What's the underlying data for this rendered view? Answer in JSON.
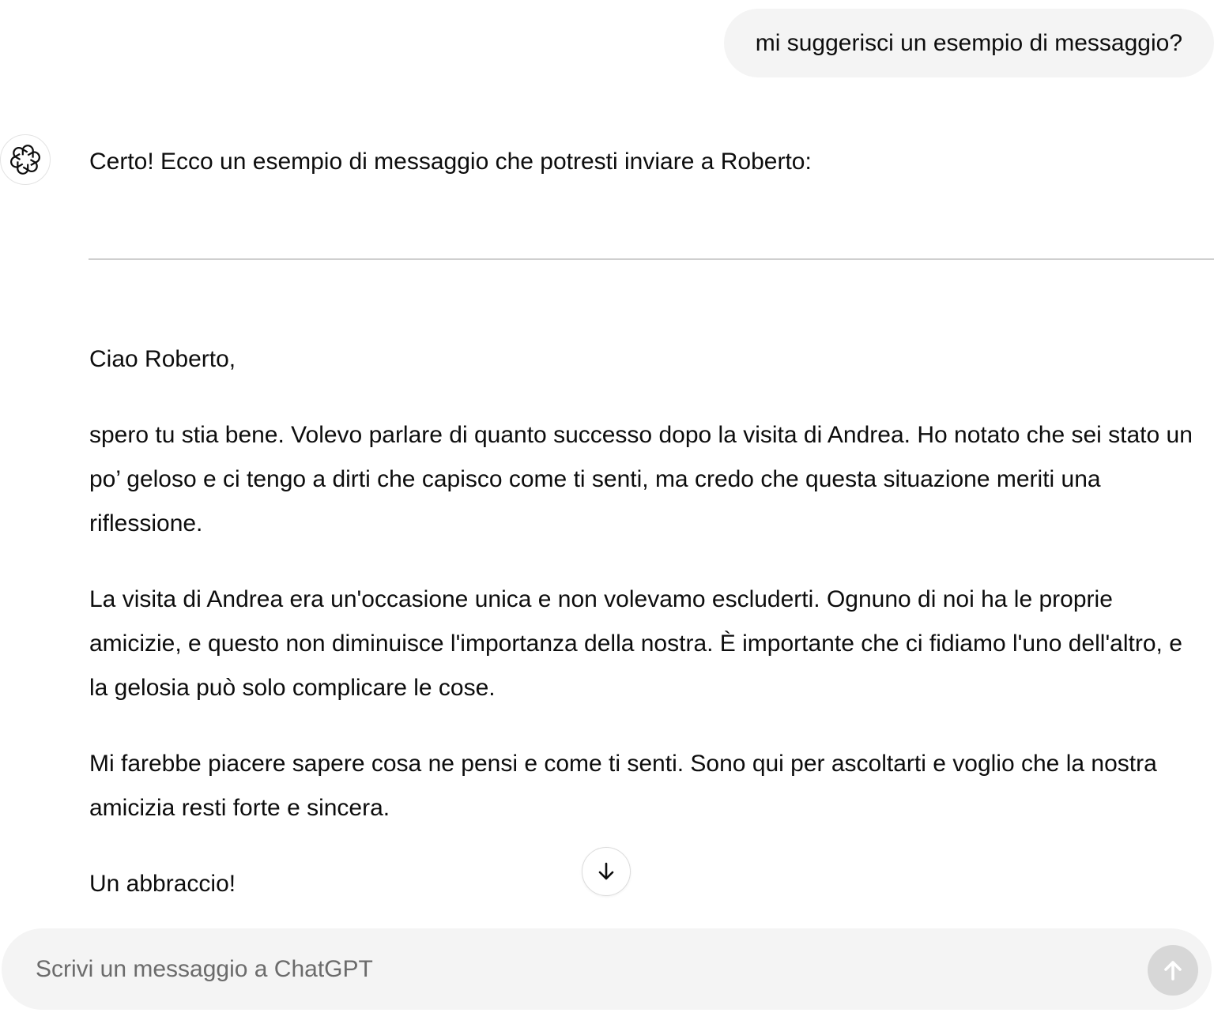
{
  "conversation": {
    "user_message": "mi suggerisci un esempio di messaggio?",
    "assistant": {
      "avatar_icon": "openai-logo-icon",
      "intro": "Certo! Ecco un esempio di messaggio che potresti inviare a Roberto:",
      "greeting": "Ciao Roberto,",
      "paragraph_1": "spero tu stia bene. Volevo parlare di quanto successo dopo la visita di Andrea. Ho notato che sei stato un po’ geloso e ci tengo a dirti che capisco come ti senti, ma credo che questa situazione meriti una riflessione.",
      "paragraph_2": "La visita di Andrea era un'occasione unica e non volevamo escluderti. Ognuno di noi ha le proprie amicizie, e questo non diminuisce l'importanza della nostra. È importante che ci fidiamo l'uno dell'altro, e la gelosia può solo complicare le cose.",
      "paragraph_3": "Mi farebbe piacere sapere cosa ne pensi e come ti senti. Sono qui per ascoltarti e voglio che la nostra amicizia resti forte e sincera.",
      "signoff": "Un abbraccio!"
    }
  },
  "scroll_button": {
    "icon": "arrow-down-icon"
  },
  "composer": {
    "placeholder": "Scrivi un messaggio a ChatGPT",
    "value": "",
    "send_icon": "arrow-up-icon"
  },
  "colors": {
    "bubble_bg": "#f4f4f4",
    "composer_bg": "#f4f4f4",
    "send_disabled_bg": "#d7d7d7",
    "text": "#0d0d0d",
    "placeholder": "#6b6b6b"
  }
}
